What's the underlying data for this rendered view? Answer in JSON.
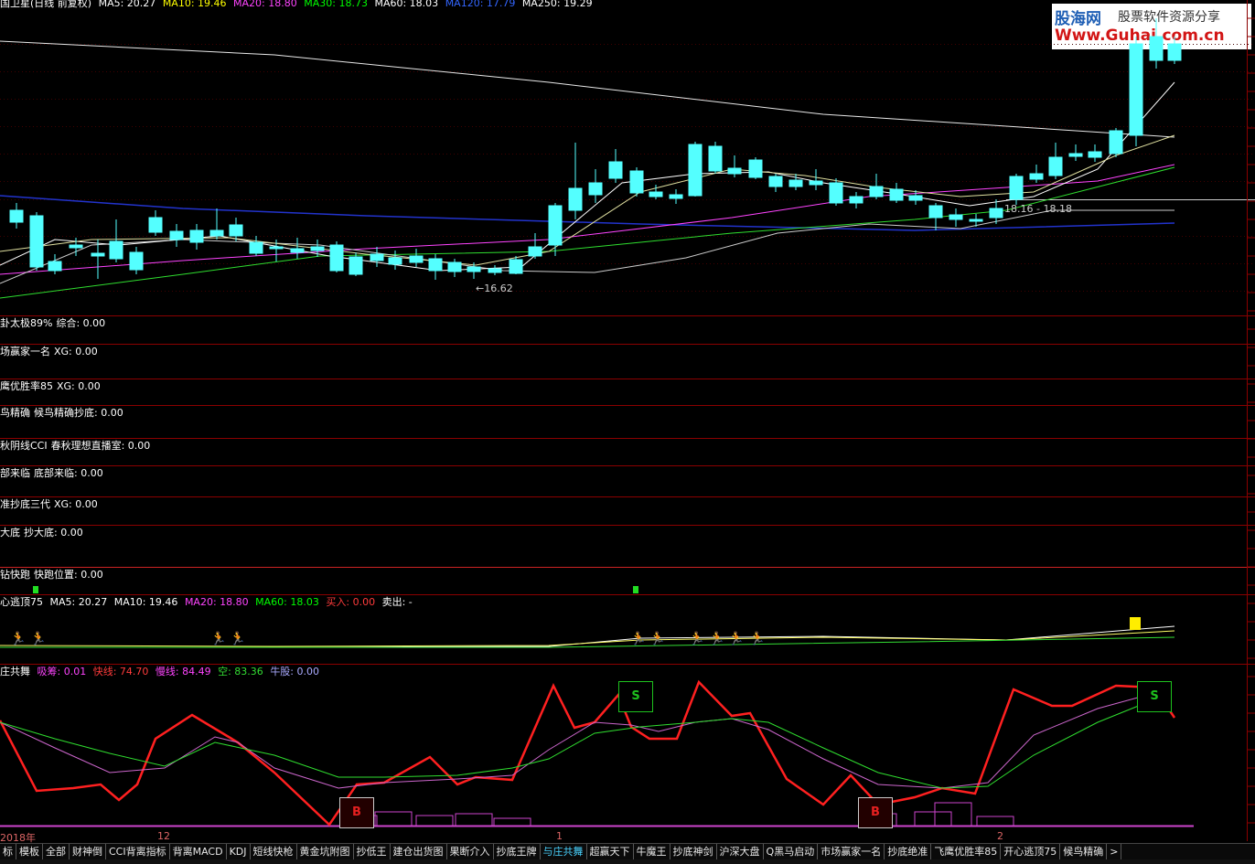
{
  "main_header": {
    "title": "国卫星(日线 前复权)",
    "ma5": "MA5: 20.27",
    "ma10": "MA10: 19.46",
    "ma20": "MA20: 18.80",
    "ma30": "MA30: 18.73",
    "ma60": "MA60: 18.03",
    "ma120": "MA120: 17.79",
    "ma250": "MA250: 19.29"
  },
  "logo": {
    "name": "股海网",
    "slogan": "股票软件资源分享",
    "url": "Www.Guhai.com.cn"
  },
  "main_labels": {
    "low": "←16.62",
    "range": "18.16 - 18.18"
  },
  "indicators": [
    {
      "name": "卦太极89%",
      "field": "综合: 0.00"
    },
    {
      "name": "场赢家一名",
      "field": "XG: 0.00"
    },
    {
      "name": "鹰优胜率85",
      "field": "XG: 0.00"
    },
    {
      "name": "鸟精确",
      "field": "候鸟精确抄底: 0.00"
    },
    {
      "name": "秋阴线CCI",
      "field": "春秋理想直播室: 0.00"
    },
    {
      "name": "部来临",
      "field": "底部来临: 0.00"
    },
    {
      "name": "准抄底三代",
      "field": "XG: 0.00"
    },
    {
      "name": "大底",
      "field": "抄大底: 0.00"
    },
    {
      "name": "钻快跑",
      "field": "快跑位置: 0.00"
    }
  ],
  "escape_panel": {
    "name": "心逃顶75",
    "ma5": "MA5: 20.27",
    "ma10": "MA10: 19.46",
    "ma20": "MA20: 18.80",
    "ma60": "MA60: 18.03",
    "buy": "买入: 0.00",
    "sell": "卖出: -"
  },
  "dance_panel": {
    "name": "庄共舞",
    "xichou": "吸筹: 0.01",
    "kuai": "快线: 74.70",
    "man": "慢线: 84.49",
    "kong": "空: 83.36",
    "niu": "牛股: 0.00",
    "s_label": "S",
    "b_label": "B"
  },
  "x_axis": {
    "year": "2018年",
    "m12": "12",
    "m1": "1",
    "m2": "2"
  },
  "tabs": [
    "标",
    "模板",
    "全部",
    "财神倒",
    "CCI背离指标",
    "背离MACD",
    "KDJ",
    "短线快枪",
    "黄金坑附图",
    "抄低王",
    "建仓出货图",
    "果断介入",
    "抄底王牌",
    "与庄共舞",
    "超赢天下",
    "牛魔王",
    "抄底神剑",
    "沪深大盘",
    "Q黑马启动",
    "市场赢家一名",
    "抄底绝准",
    "飞鹰优胜率85",
    "开心逃顶75",
    "候鸟精确"
  ],
  "active_tab": "与庄共舞",
  "tab_more": ">",
  "colors": {
    "up": "#ff3b3b",
    "down": "#54ffff",
    "grid": "#8b0000",
    "ma5": "#ffffff",
    "ma10": "#ffff00",
    "ma20": "#ff44ff",
    "ma30": "#00ff00",
    "ma60": "#00ff00",
    "ma120": "#3366ff",
    "fast_line": "#ff2020",
    "slow_line": "#cc55cc",
    "kong_line": "#33dd33"
  }
}
